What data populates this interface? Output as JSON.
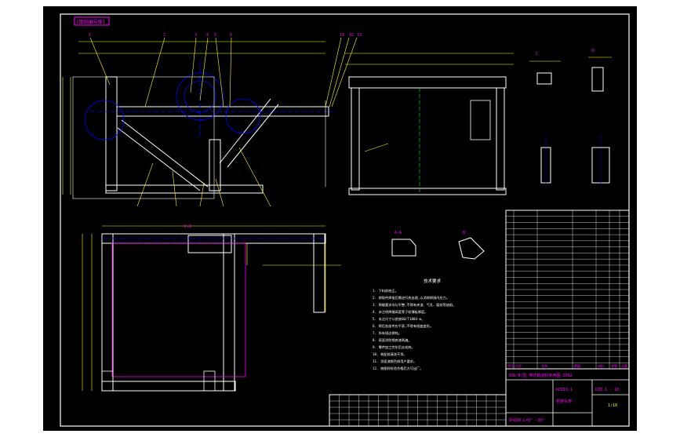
{
  "drawing": {
    "tab_label": "[图纸编号框]",
    "view_labels": {
      "section_a": "A-A",
      "detail_b": "B",
      "view_c": "C",
      "view_d": "D",
      "section_e": "E-E"
    },
    "callouts_top": [
      "1",
      "2",
      "3",
      "4",
      "5",
      "6",
      "7",
      "8",
      "9",
      "10",
      "11",
      "12",
      "13"
    ],
    "tech_requirements_title": "技术要求",
    "tech_requirements": [
      "1. 下料前校正。",
      "2. 焊接件焊接后需进行热处理,以消除焊接内应力。",
      "3. 焊缝要求均匀平整,不得有夹渣、气孔、裂纹等缺陷。",
      "4. 未注明焊缝高度等于较薄板厚度。",
      "5. 未注尺寸公差按GB/T1804-m。",
      "6. 焊后各部件应平直,不得有扭曲变形。",
      "7. 所有锐边倒钝。",
      "8. 表面涂防锈底漆两遍。",
      "9. 零件加工完毕后去毛刺。",
      "10. 装配前清洗干净。",
      "11. 涂面漆颜色按用户要求。",
      "12. 按图样检验合格后方可出厂。"
    ],
    "title_block": {
      "project": "DZⅡ(B)型 带式输送机专用图-2002",
      "drawing_no": "DZII0.1",
      "part_name": "机架头架",
      "code": "DZ0.1 - 10",
      "material_note": "B=800 L=8° -30°",
      "scale": "1:10"
    },
    "bom_header": [
      "序号",
      "代号",
      "名称",
      "数量",
      "材料",
      "单重",
      "总重",
      "备注"
    ]
  },
  "colors": {
    "background": "#000000",
    "outline": "#ffffff",
    "dimension": "#ffff00",
    "centerline": "#0000ff",
    "text": "#ff00ff",
    "hidden": "#00ff00"
  }
}
